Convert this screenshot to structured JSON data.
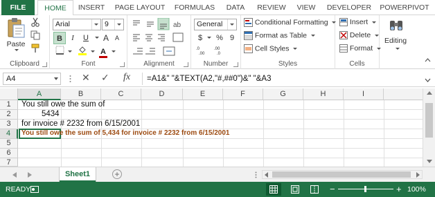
{
  "tabs": [
    "FILE",
    "HOME",
    "INSERT",
    "PAGE LAYOUT",
    "FORMULAS",
    "DATA",
    "REVIEW",
    "VIEW",
    "DEVELOPER",
    "POWERPIVOT"
  ],
  "ribbon": {
    "clipboard": {
      "label": "Clipboard",
      "paste": "Paste"
    },
    "font": {
      "label": "Font",
      "name": "Arial",
      "size": "9",
      "bold": "B",
      "italic": "I",
      "underline": "U",
      "grow": "A",
      "shrink": "A",
      "font_color_glyph": "A"
    },
    "alignment": {
      "label": "Alignment"
    },
    "number": {
      "label": "Number",
      "format": "General",
      "currency": "$",
      "percent": "%",
      "comma": "9"
    },
    "styles": {
      "label": "Styles",
      "conditional": "Conditional Formatting",
      "table": "Format as Table",
      "cell_styles": "Cell Styles"
    },
    "cells": {
      "label": "Cells",
      "insert": "Insert",
      "delete": "Delete",
      "format": "Format"
    },
    "editing": {
      "label": "Editing"
    }
  },
  "formula_bar": {
    "name_box": "A4",
    "cancel": "✕",
    "enter": "✓",
    "fx": "fx",
    "formula": "=A1&\" \"&TEXT(A2,\"#,##0\")&\" \"&A3"
  },
  "sheet": {
    "columns": [
      "A",
      "B",
      "C",
      "D",
      "E",
      "F",
      "G",
      "H",
      "I"
    ],
    "rows": [
      "1",
      "2",
      "3",
      "4",
      "5",
      "6",
      "7"
    ],
    "cells": {
      "A1": "You still owe the sum of",
      "A2": "5434",
      "A3": "for invoice # 2232 from 6/15/2001",
      "A4": "You still owe the sum of 5,434 for invoice # 2232 from 6/15/2001"
    },
    "active_cell": "A4"
  },
  "sheet_tabs": {
    "name": "Sheet1",
    "add": "+"
  },
  "status_bar": {
    "ready": "READY",
    "zoom": "100%",
    "minus": "−",
    "plus": "+"
  },
  "colors": {
    "accent": "#217346",
    "result_text": "#9c4a10"
  }
}
